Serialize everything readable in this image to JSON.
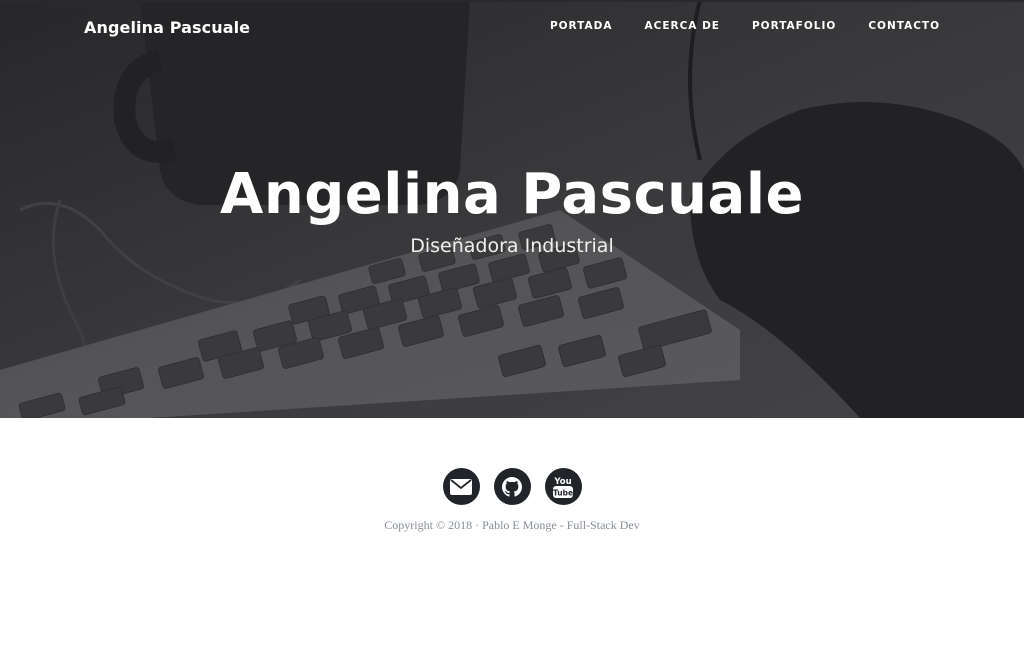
{
  "navbar": {
    "brand": "Angelina Pascuale",
    "links": [
      "PORTADA",
      "ACERCA DE",
      "PORTAFOLIO",
      "CONTACTO"
    ]
  },
  "hero": {
    "title": "Angelina Pascuale",
    "subtitle": "Diseñadora Industrial"
  },
  "footer": {
    "social": [
      {
        "icon": "envelope-icon"
      },
      {
        "icon": "github-icon"
      },
      {
        "icon": "youtube-icon",
        "label_top": "You",
        "label_bottom": "Tube"
      }
    ],
    "copyright": "Copyright © 2018 · Pablo E Monge - Full-Stack Dev"
  },
  "colors": {
    "hero_overlay": "#3c3c3e",
    "social_bg": "#212529",
    "copyright_text": "#868e96"
  }
}
